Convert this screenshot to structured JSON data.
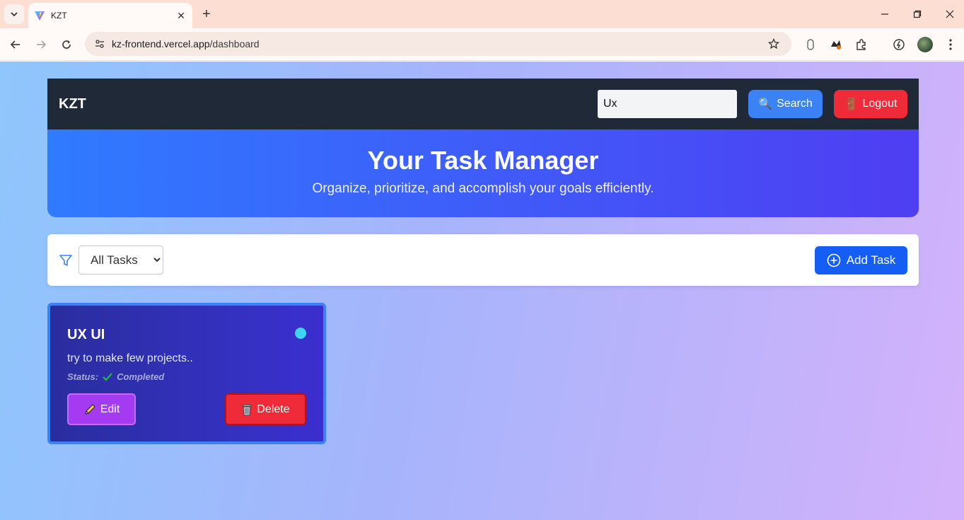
{
  "browser": {
    "tab_title": "KZT",
    "url_domain": "kz-frontend.vercel.app",
    "url_path": "/dashboard"
  },
  "navbar": {
    "brand": "KZT",
    "search_value": "Ux",
    "search_label": "Search",
    "logout_label": "Logout"
  },
  "hero": {
    "title": "Your Task Manager",
    "subtitle": "Organize, prioritize, and accomplish your goals efficiently."
  },
  "filter": {
    "selected": "All Tasks",
    "add_label": "Add Task"
  },
  "task": {
    "title": "UX UI",
    "description": "try to make few projects..",
    "status_label": "Status:",
    "status_value": "Completed",
    "edit_label": "Edit",
    "delete_label": "Delete",
    "dot_color": "#3fd4f4"
  },
  "colors": {
    "navbar": "#1f2937",
    "search_button": "#3b82f6",
    "logout_button": "#ef2a39",
    "add_button": "#155ef5",
    "edit_button": "#a43bf2"
  },
  "icons": {
    "search": "magnifier-emoji",
    "logout": "door-emoji",
    "filter": "filter-icon",
    "add": "plus-circle-icon",
    "edit": "pencil-icon",
    "delete": "trash-can-icon",
    "status": "check-mark-icon"
  }
}
